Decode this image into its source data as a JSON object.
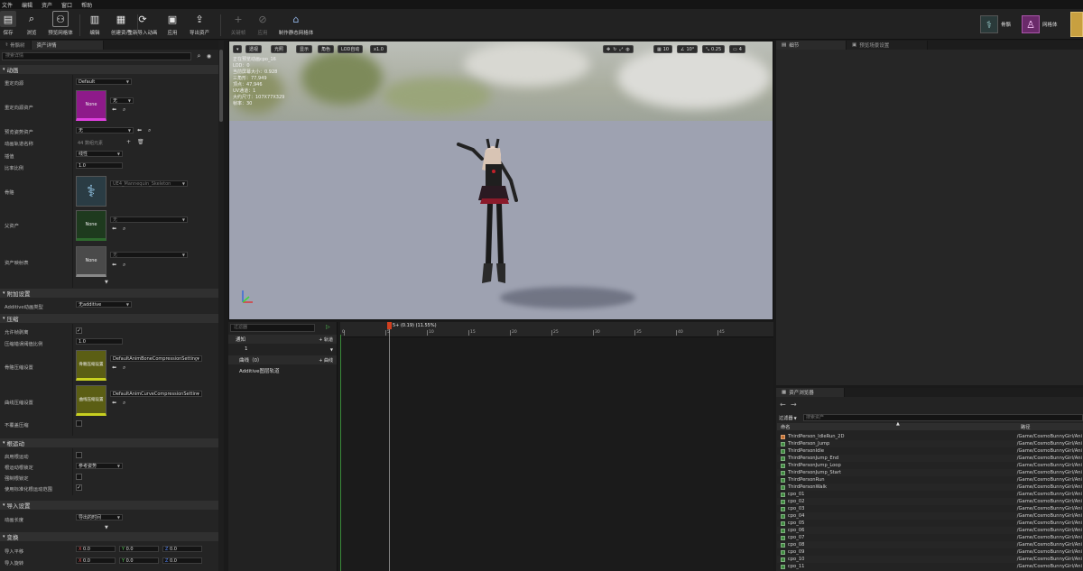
{
  "menu": [
    "文件",
    "编辑",
    "资产",
    "窗口",
    "帮助"
  ],
  "toolbar": {
    "items": [
      {
        "label": "保存",
        "icon": "save-icon",
        "glyph": "▤"
      },
      {
        "label": "浏览",
        "icon": "browse-icon",
        "glyph": "⌕"
      },
      {
        "label": "预览网格体",
        "icon": "preview-mesh-icon",
        "glyph": "⚇"
      },
      {
        "label": "编辑",
        "icon": "edit-icon",
        "glyph": "▥"
      },
      {
        "label": "创建资产",
        "icon": "create-asset-icon",
        "glyph": "▦"
      },
      {
        "label": "重新导入动画",
        "icon": "reimport-icon",
        "glyph": "⟳"
      },
      {
        "label": "应用",
        "icon": "apply-icon",
        "glyph": "▣"
      },
      {
        "label": "导出资产",
        "icon": "export-asset-icon",
        "glyph": "⇪"
      },
      {
        "label": "关键帧",
        "icon": "keyframe-icon",
        "glyph": "+"
      },
      {
        "label": "应用",
        "icon": "apply-disabled-icon",
        "glyph": "⊘"
      },
      {
        "label": "制作静态网格体",
        "icon": "static-mesh-icon",
        "glyph": "⌂"
      }
    ],
    "right": [
      {
        "label": "骨骼",
        "icon": "skeleton-icon"
      },
      {
        "label": "网格体",
        "icon": "mesh-icon"
      }
    ]
  },
  "left_panel": {
    "tabs": [
      "骨骼树",
      "资产详情"
    ],
    "search_placeholder": "搜索详情",
    "sections": {
      "animation": "动画",
      "additive": "附加设置",
      "compression": "压缩",
      "root_motion": "根运动",
      "import": "导入设置",
      "transform": "变换"
    },
    "rows": {
      "retarget_source": "重定向源",
      "retarget_source_value": "Default",
      "retarget_source_asset": "重定向源资产",
      "retarget_source_asset_value": "无",
      "thumbnail_none": "None",
      "preview_pose_asset": "预览姿势资产",
      "preview_pose_asset_value": "无",
      "anim_track_names": "动画轨道名称",
      "anim_track_names_value": "44 数组元素",
      "interpolation": "插值",
      "interpolation_value": "线性",
      "rate_scale": "比率比例",
      "rate_scale_value": "1.0",
      "skeleton": "骨骼",
      "skeleton_value": "UE4_Mannequin_Skeleton",
      "parent_asset": "父资产",
      "parent_asset_value": "无",
      "asset_mapping": "资产映射表",
      "asset_mapping_value": "无",
      "additive_anim_type": "Additive动画类型",
      "additive_anim_type_value": "无additive",
      "allow_frame_stripping": "允许帧剥离",
      "compression_error_threshold": "压缩错误阈值比例",
      "compression_error_threshold_value": "1.0",
      "bone_compression_settings": "骨骼压缩设置",
      "bone_compression_thumb": "骨骼压缩设置",
      "bone_compression_value": "DefaultAnimBoneCompressionSettings",
      "curve_compression_settings": "曲线压缩设置",
      "curve_compression_thumb": "曲线压缩设置",
      "curve_compression_value": "DefaultAnimCurveCompressionSettings",
      "do_not_override_compression": "不覆盖压缩",
      "enable_root_motion": "启用根运动",
      "root_motion_root_lock": "根运动根锁定",
      "root_motion_root_lock_value": "参考姿势",
      "force_root_lock": "强制根锁定",
      "use_normalized_root_motion_scale": "使用标准化根运动范围",
      "animation_length": "动画长度",
      "animation_length_value": "导出的时间",
      "import_translation": "导入平移",
      "import_rotation": "导入旋转",
      "x_label": "X",
      "y_label": "Y",
      "z_label": "Z",
      "zero": "0.0"
    }
  },
  "viewport": {
    "buttons": [
      "透视",
      "光照",
      "显示",
      "角色",
      "LOD自动",
      "x1.0"
    ],
    "right_buttons": [
      "10",
      "10°",
      "0.25",
      "4"
    ],
    "info": [
      "正在预览动画cpo_16",
      "LOD：0",
      "当前屏幕大小：0.928",
      "三角形：77,949",
      "顶点：47,946",
      "UV通道：1",
      "大约尺寸：107X77X329",
      "帧率：30"
    ]
  },
  "timeline": {
    "filter_placeholder": "过滤器",
    "frame_readout": "5+ (0.19) (11.55%)",
    "tracks": [
      {
        "name": "通知",
        "action": "+ 轨道"
      },
      {
        "name": "1",
        "action": ""
      },
      {
        "name": "曲线（0）",
        "action": "+ 曲线"
      },
      {
        "name": "Additive图层轨道",
        "action": ""
      }
    ],
    "ticks": [
      "0",
      "5",
      "10",
      "15",
      "20",
      "25",
      "30",
      "35",
      "40",
      "45"
    ]
  },
  "right_top": {
    "tabs": [
      "细节",
      "预览场景设置"
    ]
  },
  "content_browser": {
    "tab": "资产浏览器",
    "filter_label": "过滤器",
    "search_placeholder": "搜索资产",
    "col_name": "命名",
    "col_path": "路径",
    "rows": [
      {
        "name": "ThirdPerson_IdleRun_2D",
        "path": "/Game/CosmoBunnyGirl/Ani",
        "type": "blend"
      },
      {
        "name": "ThirdPerson_Jump",
        "path": "/Game/CosmoBunnyGirl/Ani",
        "type": "anim"
      },
      {
        "name": "ThirdPersonIdle",
        "path": "/Game/CosmoBunnyGirl/Ani",
        "type": "anim"
      },
      {
        "name": "ThirdPersonJump_End",
        "path": "/Game/CosmoBunnyGirl/Ani",
        "type": "anim"
      },
      {
        "name": "ThirdPersonJump_Loop",
        "path": "/Game/CosmoBunnyGirl/Ani",
        "type": "anim"
      },
      {
        "name": "ThirdPersonJump_Start",
        "path": "/Game/CosmoBunnyGirl/Ani",
        "type": "anim"
      },
      {
        "name": "ThirdPersonRun",
        "path": "/Game/CosmoBunnyGirl/Ani",
        "type": "anim"
      },
      {
        "name": "ThirdPersonWalk",
        "path": "/Game/CosmoBunnyGirl/Ani",
        "type": "anim"
      },
      {
        "name": "cpo_01",
        "path": "/Game/CosmoBunnyGirl/Ani",
        "type": "anim"
      },
      {
        "name": "cpo_02",
        "path": "/Game/CosmoBunnyGirl/Ani",
        "type": "anim"
      },
      {
        "name": "cpo_03",
        "path": "/Game/CosmoBunnyGirl/Ani",
        "type": "anim"
      },
      {
        "name": "cpo_04",
        "path": "/Game/CosmoBunnyGirl/Ani",
        "type": "anim"
      },
      {
        "name": "cpo_05",
        "path": "/Game/CosmoBunnyGirl/Ani",
        "type": "anim"
      },
      {
        "name": "cpo_06",
        "path": "/Game/CosmoBunnyGirl/Ani",
        "type": "anim"
      },
      {
        "name": "cpo_07",
        "path": "/Game/CosmoBunnyGirl/Ani",
        "type": "anim"
      },
      {
        "name": "cpo_08",
        "path": "/Game/CosmoBunnyGirl/Ani",
        "type": "anim"
      },
      {
        "name": "cpo_09",
        "path": "/Game/CosmoBunnyGirl/Ani",
        "type": "anim"
      },
      {
        "name": "cpo_10",
        "path": "/Game/CosmoBunnyGirl/Ani",
        "type": "anim"
      },
      {
        "name": "cpo_11",
        "path": "/Game/CosmoBunnyGirl/Ani",
        "type": "anim"
      }
    ]
  },
  "colors": {
    "thumb_magenta": "#8e1a8a",
    "thumb_green": "#1e3a1e",
    "thumb_olive": "#5b5e14",
    "accent_orange": "#d98a1f",
    "playhead": "#d04020"
  }
}
